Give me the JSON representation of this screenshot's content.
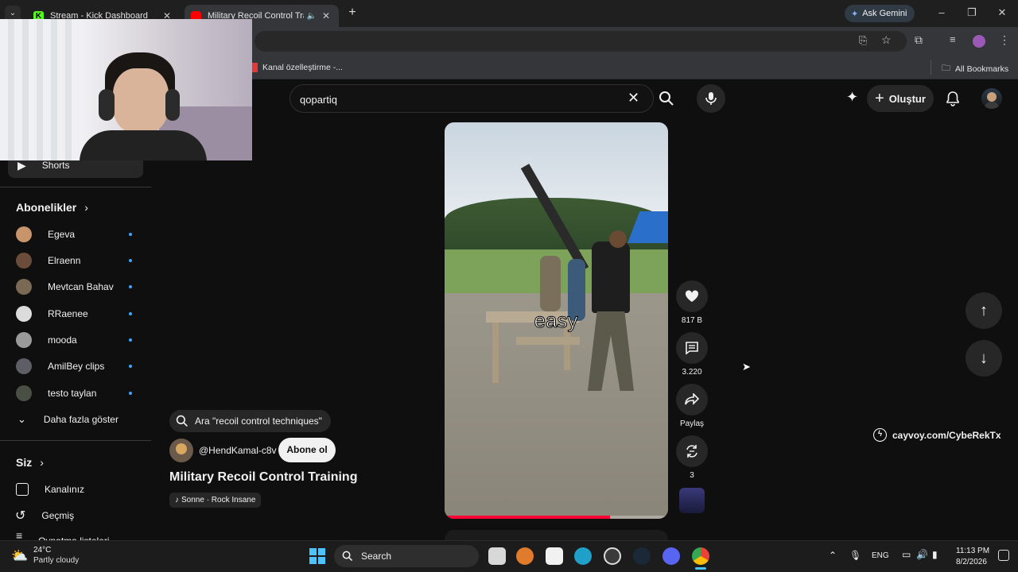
{
  "browser": {
    "tabs": [
      {
        "title": "Stream - Kick Dashboard",
        "active": false
      },
      {
        "title": "Military Recoil Control Trainin",
        "active": true
      }
    ],
    "ask_gemini": "Ask Gemini",
    "bookmark_item": "Kanal özelleştirme -...",
    "all_bookmarks": "All Bookmarks"
  },
  "youtube": {
    "search_value": "qopartiq",
    "create_label": "Oluştur",
    "sidebar": {
      "shorts": "Shorts",
      "subscriptions_heading": "Abonelikler",
      "subscriptions": [
        {
          "name": "Egeva",
          "color": "#c8946a"
        },
        {
          "name": "Elraenn",
          "color": "#6b4b3a"
        },
        {
          "name": "Mevtcan Bahav",
          "color": "#7a6a55"
        },
        {
          "name": "RRaenee",
          "color": "#dcdcdc"
        },
        {
          "name": "mooda",
          "color": "#9a9a9a"
        },
        {
          "name": "AmilBey clips",
          "color": "#5e5e66"
        },
        {
          "name": "testo taylan",
          "color": "#4a4f44"
        }
      ],
      "show_more": "Daha fazla göster",
      "you_heading": "Siz",
      "you_items": [
        "Kanalınız",
        "Geçmiş",
        "Oynatma listeleri"
      ]
    },
    "short": {
      "search_suggestion": "Ara \"recoil control techniques\"",
      "channel": "@HendKamal-c8v",
      "subscribe": "Abone ol",
      "title": "Military Recoil Control Training",
      "music": "Sonne · Rock Insane",
      "caption": "easy",
      "progress": 0.74,
      "likes": "817 B",
      "comments": "3.220",
      "share": "Paylaş",
      "remix": "3"
    },
    "overlay_link": "cayvoy.com/CybeRekTx"
  },
  "taskbar": {
    "temperature": "24°C",
    "weather": "Partly cloudy",
    "search": "Search",
    "language": "ENG",
    "time": "11:13 PM",
    "date": "8/2/2026"
  }
}
